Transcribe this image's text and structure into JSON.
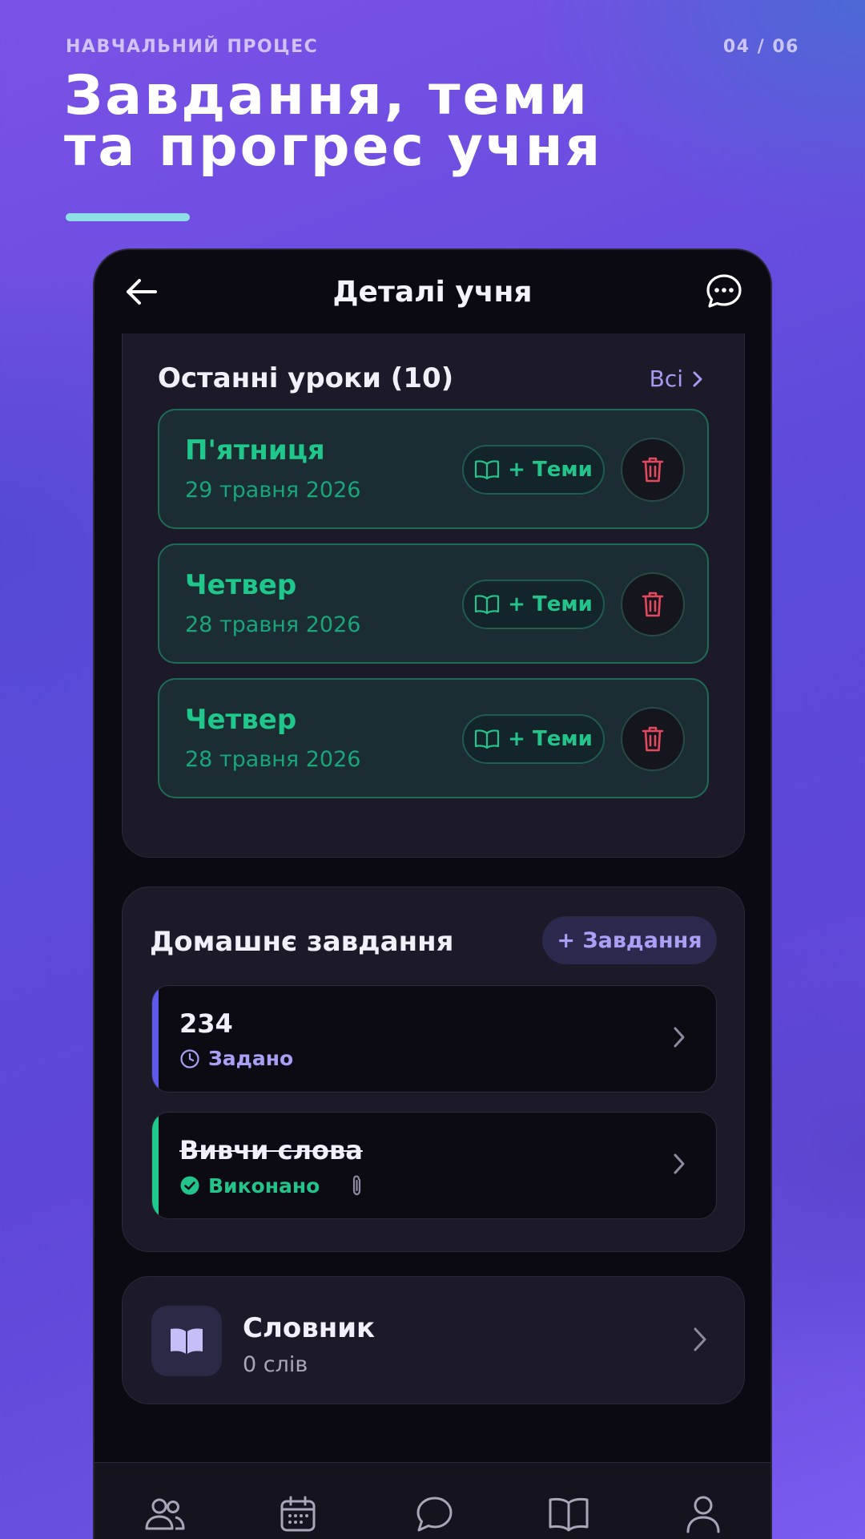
{
  "slide": {
    "kicker": "НАВЧАЛЬНИЙ ПРОЦЕС",
    "pager": "04 / 06",
    "headline_line1": "Завдання, теми",
    "headline_line2": "та прогрес учня",
    "accent_color": "#8fe0e6"
  },
  "header": {
    "title": "Деталі учня",
    "back_icon": "arrow-left-icon",
    "chat_icon": "chat-bubble-dots-icon"
  },
  "lessons": {
    "title": "Останні уроки (10)",
    "see_all_label": "Всі",
    "topics_label": "+ Теми",
    "items": [
      {
        "day": "П'ятниця",
        "date": "29 травня 2026"
      },
      {
        "day": "Четвер",
        "date": "28 травня 2026"
      },
      {
        "day": "Четвер",
        "date": "28 травня 2026"
      }
    ],
    "accent_color": "#1fc78a",
    "delete_color": "#e5485c"
  },
  "homework": {
    "title": "Домашнє завдання",
    "add_label": "+ Завдання",
    "items": [
      {
        "title": "234",
        "status": "Задано",
        "status_color": "#a8a0f4",
        "stripe_color": "#5f5ae6"
      },
      {
        "title": "Вивчи слова",
        "status": "Виконано",
        "status_color": "#22c48a",
        "stripe_color": "#1fc78a"
      }
    ]
  },
  "dictionary": {
    "title": "Словник",
    "subtitle": "0 слів",
    "icon": "open-book-icon"
  },
  "nav": {
    "items": [
      "students-icon",
      "calendar-icon",
      "chat-icon",
      "book-icon",
      "profile-icon"
    ]
  }
}
